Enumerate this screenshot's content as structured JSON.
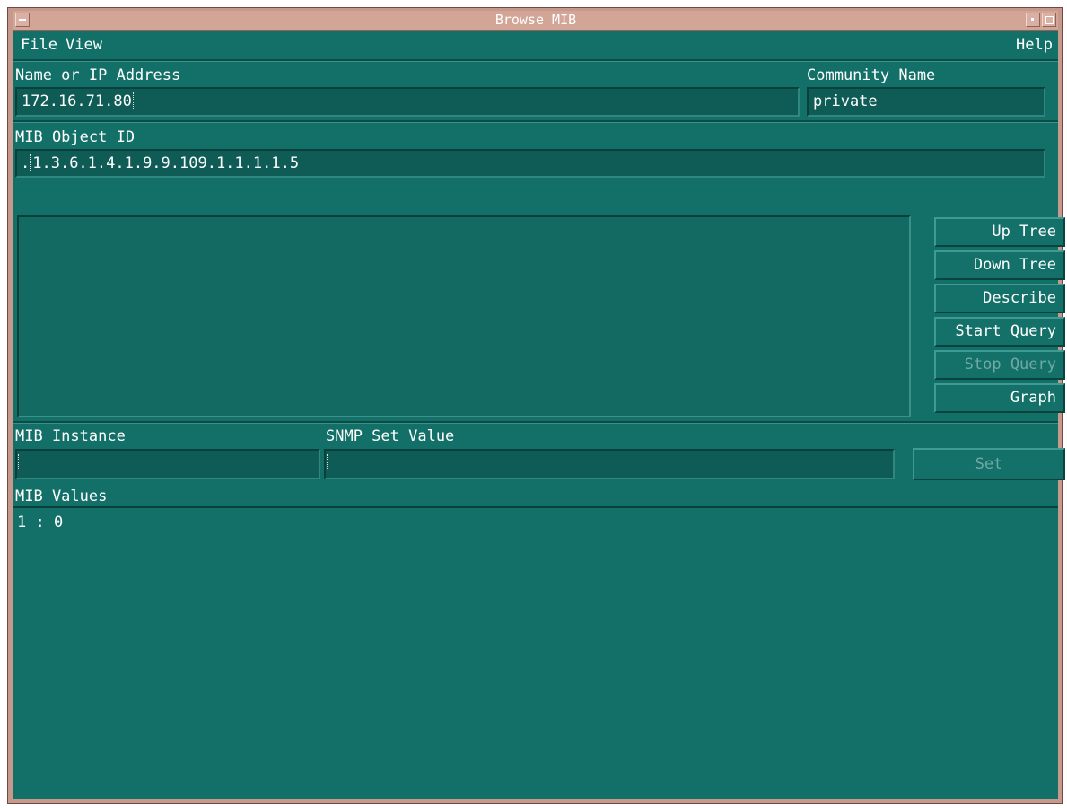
{
  "window": {
    "title": "Browse MIB"
  },
  "menubar": {
    "file": "File",
    "view": "View",
    "help": "Help"
  },
  "address": {
    "label": "Name or IP Address",
    "value": "172.16.71.80"
  },
  "community": {
    "label": "Community Name",
    "value": "private"
  },
  "object_id": {
    "label": "MIB Object ID",
    "prefix": ".",
    "value": "1.3.6.1.4.1.9.9.109.1.1.1.1.5"
  },
  "buttons": {
    "up_tree": "Up Tree",
    "down_tree": "Down Tree",
    "describe": "Describe",
    "start_query": "Start Query",
    "stop_query": "Stop Query",
    "graph": "Graph",
    "set": "Set"
  },
  "instance": {
    "label": "MIB Instance",
    "value": ""
  },
  "set_value": {
    "label": "SNMP Set Value",
    "value": ""
  },
  "values": {
    "label": "MIB Values",
    "lines": [
      "1 : 0"
    ]
  },
  "colors": {
    "client_bg": "#137068",
    "titlebar": "#d2a597",
    "text": "#ffffff",
    "disabled_text": "#6fa9a3"
  }
}
